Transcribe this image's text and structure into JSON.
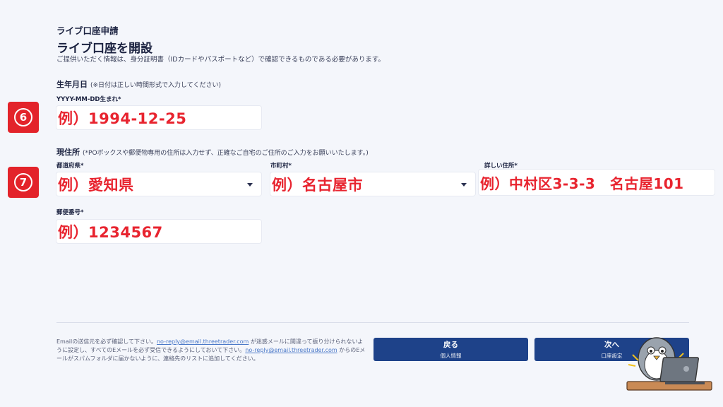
{
  "header": {
    "breadcrumb": "ライブ口座申請",
    "title": "ライブ口座を開設",
    "description": "ご提供いただく情報は、身分証明書（IDカードやパスポートなど）で確認できるものである必要があります。"
  },
  "birth": {
    "section_label": "生年月日",
    "section_note": "(※日付は正しい時間形式で入力してください)",
    "field_label": "YYYY-MM-DD生まれ*",
    "value": "例）1994-12-25",
    "step_badge": "6"
  },
  "address": {
    "section_label": "現住所",
    "section_note": "(*POボックスや郵便物専用の住所は入力せず、正確なご自宅のご住所のご入力をお願いいたします。)",
    "step_badge": "7",
    "prefecture": {
      "label": "都道府県*",
      "value": "例）愛知県"
    },
    "city": {
      "label": "市町村*",
      "value": "例）名古屋市"
    },
    "detail": {
      "label": "詳しい住所*",
      "value": "例）中村区3-3-3　名古屋101"
    },
    "postal": {
      "label": "郵便番号*",
      "value": "例）1234567"
    }
  },
  "footer": {
    "note_1": "Emailの送信元を必ず確認して下さい。",
    "email_1": "no-reply@email.threetrader.com",
    "note_2": " が迷惑メールに間違って振り分けられないように設定し、すべてのEメールを必ず受信できるようにしておいて下さい。",
    "email_2": "no-reply@email.threetrader.com",
    "note_3": " からのEメールがスパムフォルダに届かないように、連絡先のリストに追加してください。",
    "back_button": {
      "label": "戻る",
      "sub": "個人情報"
    },
    "next_button": {
      "label": "次へ",
      "sub": "口座設定"
    }
  },
  "colors": {
    "accent_red": "#e3232a",
    "button_navy": "#1e4289",
    "link_blue": "#4a78c8"
  }
}
